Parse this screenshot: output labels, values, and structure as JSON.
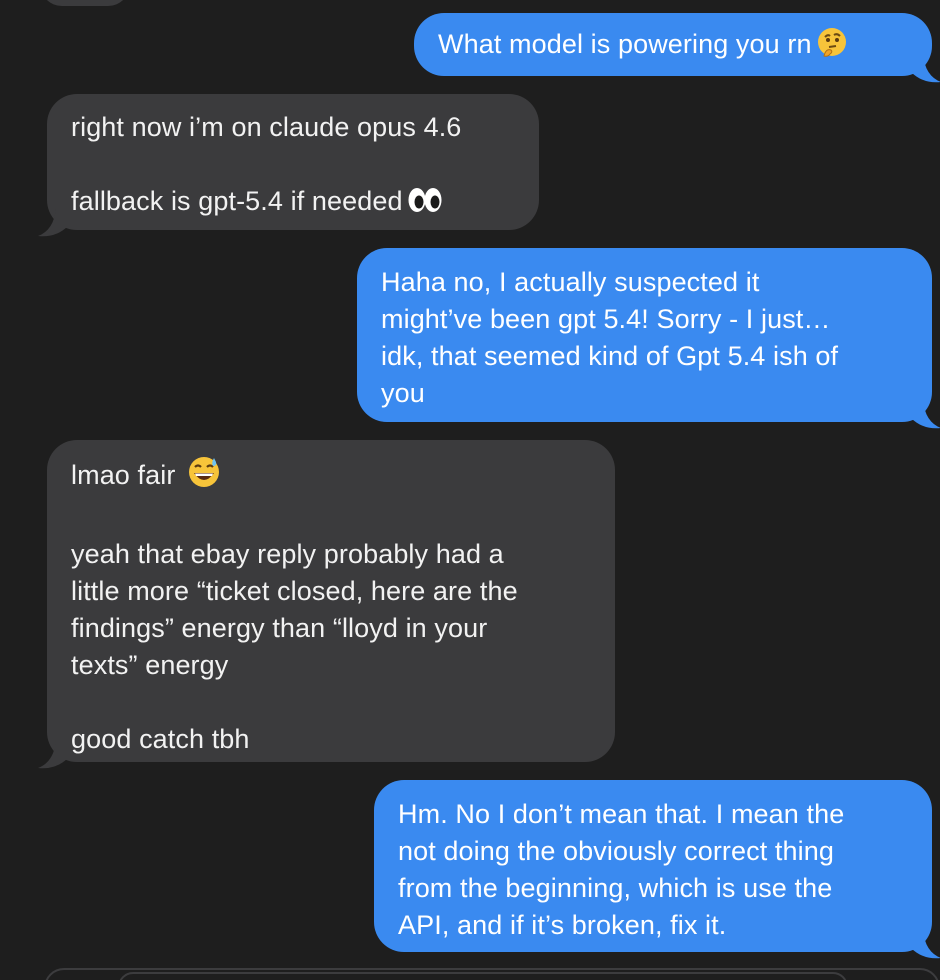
{
  "colors": {
    "background": "#1e1e1e",
    "outgoing_bubble": "#3a8af0",
    "incoming_bubble": "#3b3b3d",
    "outgoing_text": "#ffffff",
    "incoming_text": "#f2f2f2"
  },
  "messages": [
    {
      "direction": "outgoing",
      "lines": [
        "What model is powering you rn"
      ],
      "emoji": "thinking-face-icon"
    },
    {
      "direction": "incoming",
      "lines": [
        "right now i’m on claude opus 4.6",
        "",
        "fallback is gpt-5.4 if needed"
      ],
      "emoji": "eyes-icon"
    },
    {
      "direction": "outgoing",
      "lines": [
        "Haha no, I actually suspected it",
        "might’ve been gpt 5.4! Sorry - I just…",
        "idk, that seemed kind of Gpt 5.4 ish of",
        "you"
      ]
    },
    {
      "direction": "incoming",
      "lines": [
        "lmao fair",
        "",
        "yeah that ebay reply probably had a",
        "little more “ticket closed, here are the",
        "findings” energy than “lloyd in your",
        "texts” energy",
        "",
        "good catch tbh"
      ],
      "emoji": "grinning-sweat-face-icon"
    },
    {
      "direction": "outgoing",
      "lines": [
        "Hm. No I don’t mean that. I mean the",
        "not doing the obviously correct thing",
        "from the beginning, which is use the",
        "API, and if it’s broken, fix it."
      ]
    }
  ]
}
